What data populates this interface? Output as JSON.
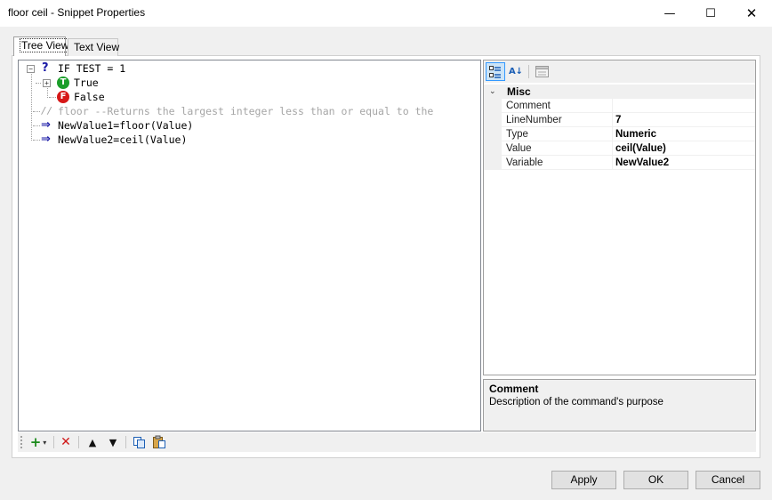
{
  "window": {
    "title": "floor ceil - Snippet Properties",
    "minimize_glyph": "—",
    "maximize_glyph": "☐",
    "close_glyph": "✕"
  },
  "tabs": [
    {
      "label": "Tree View",
      "active": true
    },
    {
      "label": "Text View",
      "active": false
    }
  ],
  "tree": {
    "nodes": [
      {
        "text": "IF TEST = 1",
        "icon": "question-icon",
        "expander": "−"
      },
      {
        "text": "True",
        "icon": "true-icon",
        "badge": "T",
        "expander": "+"
      },
      {
        "text": "False",
        "icon": "false-icon",
        "badge": "F"
      },
      {
        "text": "floor --Returns the largest integer less than or equal to the",
        "icon": "comment-icon",
        "glyph": "//"
      },
      {
        "text": "NewValue1=floor(Value)",
        "icon": "assign-arrow-icon",
        "glyph": "⇒"
      },
      {
        "text": "NewValue2=ceil(Value)",
        "icon": "assign-arrow-icon",
        "glyph": "⇒"
      }
    ]
  },
  "toolbar": {
    "add_glyph": "+",
    "dropdown_glyph": "▾",
    "delete_glyph": "✕",
    "up_glyph": "▲",
    "down_glyph": "▼"
  },
  "property_grid": {
    "sort_glyph": "A↓",
    "category": {
      "label": "Misc",
      "chevron": "⌄"
    },
    "rows": [
      {
        "name": "Comment",
        "value": ""
      },
      {
        "name": "LineNumber",
        "value": "7"
      },
      {
        "name": "Type",
        "value": "Numeric"
      },
      {
        "name": "Value",
        "value": "ceil(Value)"
      },
      {
        "name": "Variable",
        "value": "NewValue2"
      }
    ],
    "help": {
      "title": "Comment",
      "description": "Description of the command's purpose"
    }
  },
  "buttons": {
    "apply": "Apply",
    "ok": "OK",
    "cancel": "Cancel"
  },
  "colors": {
    "true_badge": "#1b9e2a",
    "false_badge": "#d61818",
    "keyword_blue": "#1a1aa6",
    "comment_gray": "#a6a6a6"
  }
}
